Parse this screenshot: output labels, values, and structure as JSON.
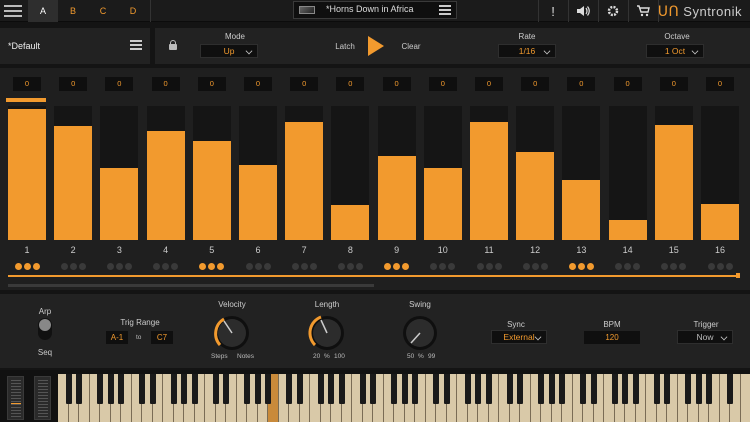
{
  "topbar": {
    "tabs": [
      "A",
      "B",
      "C",
      "D"
    ],
    "active_tab": 0,
    "preset_title": "*Horns Down in Africa",
    "icons": [
      "alert-icon",
      "speaker-icon",
      "gear-icon",
      "cart-icon"
    ],
    "logo_text": "Syntronik"
  },
  "bar2": {
    "preset_name": "*Default",
    "mode_label": "Mode",
    "mode_value": "Up",
    "latch_label": "Latch",
    "clear_label": "Clear",
    "rate_label": "Rate",
    "rate_value": "1/16",
    "octave_label": "Octave",
    "octave_value": "1 Oct"
  },
  "sequencer": {
    "step_values": [
      "0",
      "0",
      "0",
      "0",
      "0",
      "0",
      "0",
      "0",
      "0",
      "0",
      "0",
      "0",
      "0",
      "0",
      "0",
      "0"
    ],
    "step_numbers": [
      "1",
      "2",
      "3",
      "4",
      "5",
      "6",
      "7",
      "8",
      "9",
      "10",
      "11",
      "12",
      "13",
      "14",
      "15",
      "16"
    ],
    "step_levels": [
      0.98,
      0.85,
      0.54,
      0.81,
      0.74,
      0.56,
      0.88,
      0.26,
      0.63,
      0.54,
      0.88,
      0.66,
      0.45,
      0.15,
      0.86,
      0.27
    ],
    "dots_active": [
      true,
      false,
      false,
      false,
      true,
      false,
      false,
      false,
      true,
      false,
      false,
      false,
      true,
      false,
      false,
      false
    ],
    "accent_color": "#f29a2e"
  },
  "controls": {
    "arp_label": "Arp",
    "seq_label": "Seq",
    "trig_range_label": "Trig Range",
    "trig_from": "A-1",
    "trig_to_label": "to",
    "trig_to": "C7",
    "velocity_label": "Velocity",
    "velocity_left": "Steps",
    "velocity_right": "Notes",
    "length_label": "Length",
    "length_min": "20",
    "length_unit": "%",
    "length_max": "100",
    "swing_label": "Swing",
    "swing_min": "50",
    "swing_unit": "%",
    "swing_max": "99",
    "sync_label": "Sync",
    "sync_value": "External",
    "bpm_label": "BPM",
    "bpm_value": "120",
    "trigger_label": "Trigger",
    "trigger_value": "Now"
  }
}
